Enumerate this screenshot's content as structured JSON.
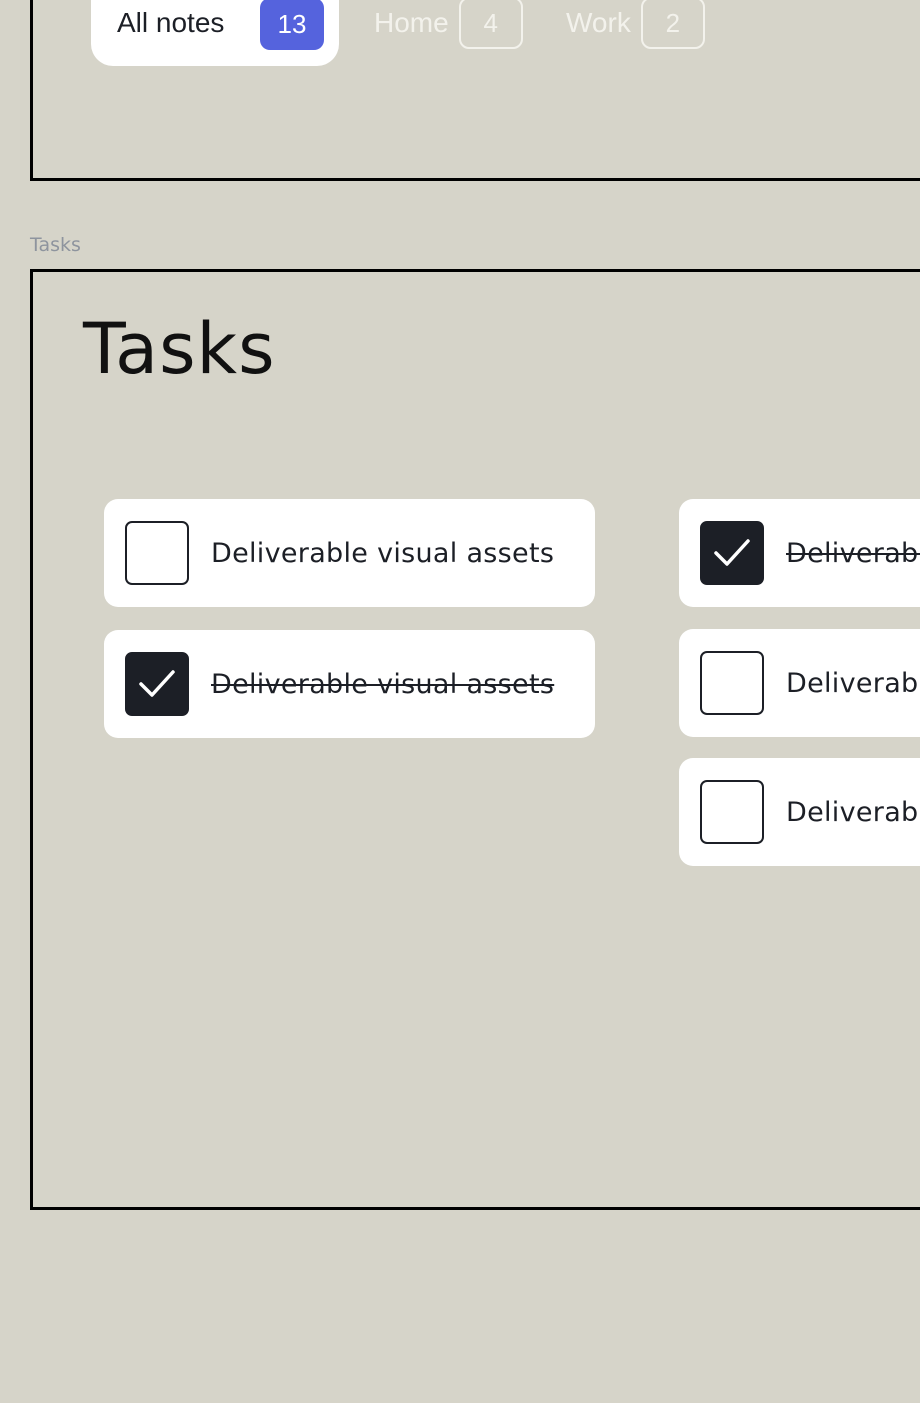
{
  "filter_tabs": [
    {
      "label": "All notes",
      "count": "13",
      "active": true
    },
    {
      "label": "Home",
      "count": "4",
      "active": false
    },
    {
      "label": "Work",
      "count": "2",
      "active": false
    }
  ],
  "frame_label": "Tasks",
  "page_title": "Tasks",
  "tasks_left": [
    {
      "label": "Deliverable visual assets",
      "done": false
    },
    {
      "label": "Deliverable visual assets",
      "done": true
    }
  ],
  "tasks_right": [
    {
      "label": "Deliverable visual assets",
      "done": true
    },
    {
      "label": "Deliverable visual assets",
      "done": false
    },
    {
      "label": "Deliverable visual assets",
      "done": false
    }
  ],
  "colors": {
    "background": "#d6d4c9",
    "accent": "#5563dd",
    "checkbox_checked": "#1c1f26",
    "card": "#ffffff"
  },
  "icons": {
    "check": "checkmark-icon"
  }
}
